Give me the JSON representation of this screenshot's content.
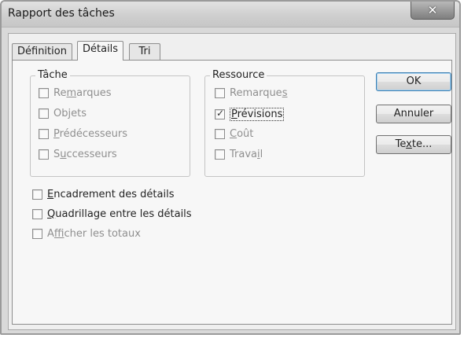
{
  "window": {
    "title": "Rapport des tâches",
    "close_symbol": "✕"
  },
  "tabs": [
    {
      "label": "Définition",
      "active": false
    },
    {
      "label": "Détails",
      "active": true
    },
    {
      "label": "Tri",
      "active": false
    }
  ],
  "task_group": {
    "legend": "Tâche",
    "items": [
      {
        "pre": "Re",
        "mnemonic": "m",
        "post": "arques",
        "checked": false,
        "disabled": true
      },
      {
        "pre": "Ob",
        "mnemonic": "j",
        "post": "ets",
        "checked": false,
        "disabled": true
      },
      {
        "pre": "",
        "mnemonic": "P",
        "post": "rédécesseurs",
        "checked": false,
        "disabled": true
      },
      {
        "pre": "S",
        "mnemonic": "u",
        "post": "ccesseurs",
        "checked": false,
        "disabled": true
      }
    ]
  },
  "resource_group": {
    "legend": "Ressource",
    "items": [
      {
        "pre": "Remarque",
        "mnemonic": "s",
        "post": "",
        "checked": false,
        "disabled": true
      },
      {
        "pre": "",
        "mnemonic": "P",
        "post": "révisions",
        "checked": true,
        "disabled": false,
        "focused": true
      },
      {
        "pre": "",
        "mnemonic": "C",
        "post": "oût",
        "checked": false,
        "disabled": true
      },
      {
        "pre": "Trava",
        "mnemonic": "i",
        "post": "l",
        "checked": false,
        "disabled": true
      }
    ]
  },
  "options": [
    {
      "pre": "",
      "mnemonic": "E",
      "post": "ncadrement des détails",
      "checked": false,
      "disabled": false
    },
    {
      "pre": "",
      "mnemonic": "Q",
      "post": "uadrillage entre les détails",
      "checked": false,
      "disabled": false
    },
    {
      "pre": "A",
      "mnemonic": "f",
      "post": "ficher les totaux",
      "checked": false,
      "disabled": true
    }
  ],
  "buttons": {
    "ok": "OK",
    "cancel": "Annuler",
    "text_pre": "Te",
    "text_mnemonic": "x",
    "text_post": "te..."
  }
}
